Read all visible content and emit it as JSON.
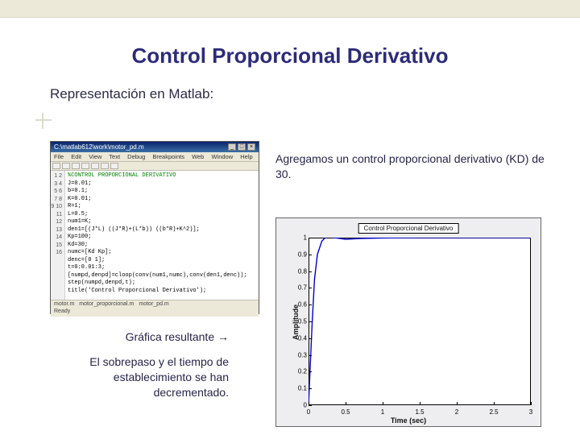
{
  "title": "Control Proporcional Derivativo",
  "subhead": "Representación en Matlab:",
  "desc": "Agregamos un control proporcional derivativo (KD) de 30.",
  "result_label": "Gráfica resultante →",
  "result_text": "El sobrepaso y el tiempo de establecimiento se han decrementado.",
  "editor": {
    "path": "C:\\matlab612\\work\\motor_pd.m",
    "menu": [
      "File",
      "Edit",
      "View",
      "Text",
      "Debug",
      "Breakpoints",
      "Web",
      "Window",
      "Help"
    ],
    "lines": [
      {
        "c": true,
        "t": "%CONTROL PROPORCIONAL DERIVATIVO"
      },
      {
        "c": false,
        "t": "J=0.01;"
      },
      {
        "c": false,
        "t": "b=0.1;"
      },
      {
        "c": false,
        "t": "K=0.01;"
      },
      {
        "c": false,
        "t": "R=1;"
      },
      {
        "c": false,
        "t": "L=0.5;"
      },
      {
        "c": false,
        "t": "num1=K;"
      },
      {
        "c": false,
        "t": "den1=[(J*L) ((J*R)+(L*b)) ((b*R)+K^2)];"
      },
      {
        "c": false,
        "t": "Kp=100;"
      },
      {
        "c": false,
        "t": "Kd=30;"
      },
      {
        "c": false,
        "t": "numc=[Kd Kp];"
      },
      {
        "c": false,
        "t": "denc=[0 1];"
      },
      {
        "c": false,
        "t": "t=0:0.01:3;"
      },
      {
        "c": false,
        "t": "[numpd,denpd]=cloop(conv(num1,numc),conv(den1,denc));"
      },
      {
        "c": false,
        "t": "step(numpd,denpd,t);"
      },
      {
        "c": false,
        "t": "title('Control Proporcional Derivativo');"
      }
    ],
    "tabs": [
      "motor.m",
      "motor_proporcional.m",
      "motor_pd.m"
    ],
    "status": "Ready"
  },
  "chart_data": {
    "type": "line",
    "title": "Control Proporcional Derivativo",
    "xlabel": "Time (sec)",
    "ylabel": "Amplitude",
    "xlim": [
      0,
      3
    ],
    "ylim": [
      0,
      1
    ],
    "xticks": [
      0,
      0.5,
      1,
      1.5,
      2,
      2.5,
      3
    ],
    "yticks": [
      0,
      0.1,
      0.2,
      0.3,
      0.4,
      0.5,
      0.6,
      0.7,
      0.8,
      0.9,
      1
    ],
    "x": [
      0,
      0.02,
      0.05,
      0.08,
      0.12,
      0.18,
      0.25,
      0.35,
      0.5,
      0.7,
      1.0,
      1.5,
      2.0,
      2.5,
      3.0
    ],
    "y": [
      0,
      0.2,
      0.5,
      0.75,
      0.9,
      0.98,
      1.01,
      1.0,
      0.99,
      0.995,
      0.998,
      1.0,
      1.0,
      1.0,
      1.0
    ]
  }
}
